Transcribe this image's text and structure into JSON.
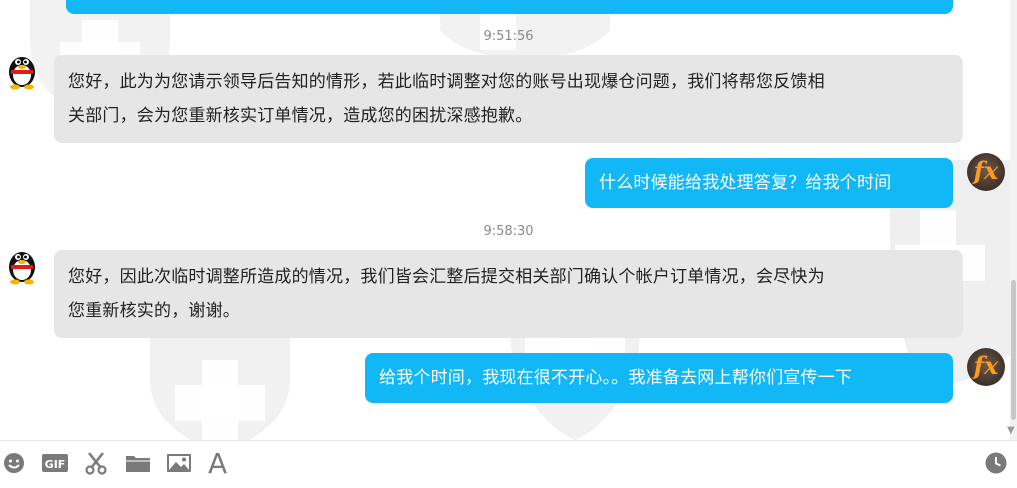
{
  "messages": [
    {
      "time": "9:51:56"
    },
    {
      "side": "left",
      "avatar": "qq-penguin-avatar",
      "text_line1": "您好，此为为您请示领导后告知的情形，若此临时调整对您的账号出现爆仓问题，我们将帮您反馈相",
      "text_line2": "关部门，会为您重新核实订单情况，造成您的困扰深感抱歉。"
    },
    {
      "side": "right",
      "avatar": "fx-avatar",
      "text": "什么时候能给我处理答复？给我个时间"
    },
    {
      "time": "9:58:30"
    },
    {
      "side": "left",
      "avatar": "qq-penguin-avatar",
      "text_line1": "您好，因此次临时调整所造成的情况，我们皆会汇整后提交相关部门确认个帐户订单情况，会尽快为",
      "text_line2": "您重新核实的，谢谢。"
    },
    {
      "side": "right",
      "avatar": "fx-avatar",
      "text": "给我个时间，我现在很不开心。。我准备去网上帮你们宣传一下"
    }
  ],
  "user_avatar_text": "fx",
  "toolbar": {
    "icons": [
      "emoji-icon",
      "gif-icon",
      "scissors-icon",
      "folder-icon",
      "image-icon",
      "font-icon",
      "clock-icon"
    ],
    "gif_label": "GIF",
    "font_label": "A"
  },
  "colors": {
    "bubble_right": "#12b7f5",
    "bubble_left": "#e6e6e6",
    "timestamp": "#8a8a8a",
    "icon": "#7a7a7a"
  }
}
